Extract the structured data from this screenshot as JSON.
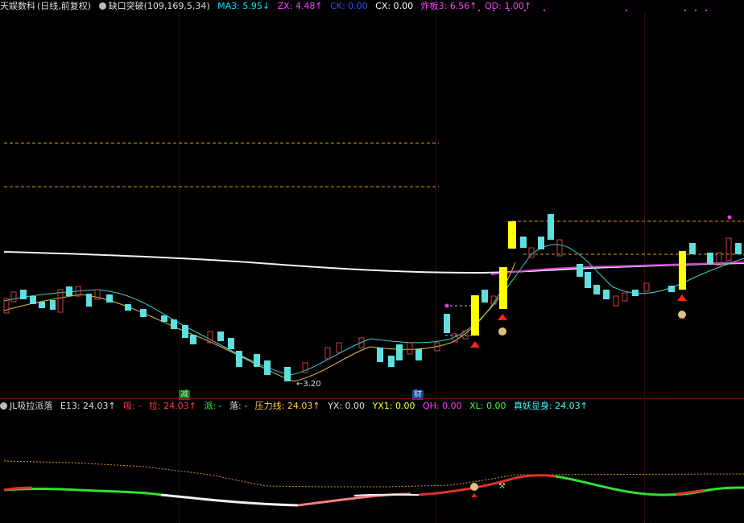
{
  "top_header": {
    "stock": "天娱数科",
    "period": "(日线,前复权)",
    "indicator": "缺口突破(109,169,5,34)",
    "items": [
      {
        "label": "MA3: 5.95↓",
        "color": "#00e5ff"
      },
      {
        "label": "ZX: 4.48↑",
        "color": "#ff40ff"
      },
      {
        "label": "CK: 0.00",
        "color": "#3050ff"
      },
      {
        "label": "CX: 0.00",
        "color": "#ffffff"
      },
      {
        "label": "炸板3: 6.56↑",
        "color": "#ff40ff"
      },
      {
        "label": "QD: 1.00↑",
        "color": "#ff40ff"
      }
    ]
  },
  "bottom_header": {
    "indicator": "JL吸拉派落",
    "items": [
      {
        "label": "E13: 24.03↑",
        "color": "#dddddd"
      },
      {
        "label": "吸: -",
        "color": "#ff4040"
      },
      {
        "label": "拉: 24.03↑",
        "color": "#ff4040"
      },
      {
        "label": "派: -",
        "color": "#40ff40"
      },
      {
        "label": "落: -",
        "color": "#dddddd"
      },
      {
        "label": "压力线: 24.03↑",
        "color": "#ffd040"
      },
      {
        "label": "YX: 0.00",
        "color": "#dddddd"
      },
      {
        "label": "YX1: 0.00",
        "color": "#ffff40"
      },
      {
        "label": "QH: 0.00",
        "color": "#ff40ff"
      },
      {
        "label": "XL: 0.00",
        "color": "#40ff40"
      },
      {
        "label": "真妖显身: 24.03↑",
        "color": "#40ffff"
      }
    ]
  },
  "annotations": {
    "low_price": "←3.20",
    "marker_jian": "减",
    "marker_cai": "财"
  }
}
